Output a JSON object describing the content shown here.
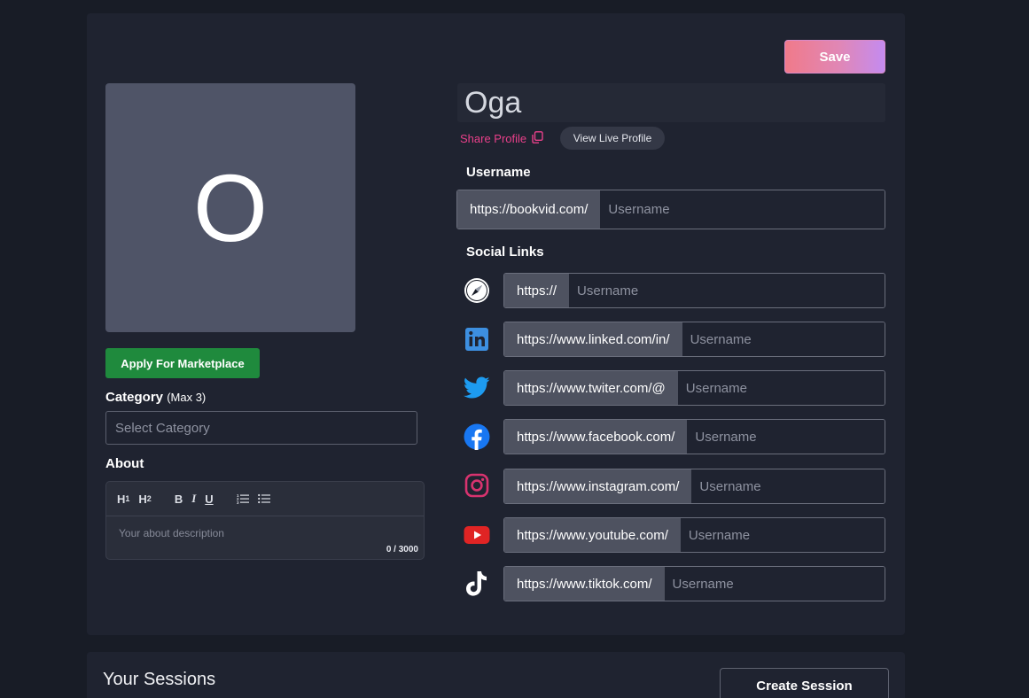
{
  "profile": {
    "save_label": "Save",
    "avatar_initial": "O",
    "name": "Oga",
    "share_label": "Share Profile",
    "view_live_label": "View Live Profile",
    "apply_marketplace_label": "Apply For Marketplace",
    "category": {
      "label": "Category",
      "hint": "(Max 3)",
      "placeholder": "Select Category"
    },
    "about": {
      "label": "About",
      "toolbar": [
        "H1",
        "H2",
        "B",
        "I",
        "U",
        "ordered-list",
        "bullet-list"
      ],
      "placeholder": "Your about description",
      "counter": "0 / 3000"
    },
    "username": {
      "label": "Username",
      "prefix": "https://bookvid.com/",
      "placeholder": "Username"
    },
    "social_links": {
      "label": "Social Links",
      "items": [
        {
          "icon": "safari-icon",
          "prefix": "https://",
          "placeholder": "Username"
        },
        {
          "icon": "linkedin-icon",
          "prefix": "https://www.linked.com/in/",
          "placeholder": "Username"
        },
        {
          "icon": "twitter-icon",
          "prefix": "https://www.twiter.com/@",
          "placeholder": "Username"
        },
        {
          "icon": "facebook-icon",
          "prefix": "https://www.facebook.com/",
          "placeholder": "Username"
        },
        {
          "icon": "instagram-icon",
          "prefix": "https://www.instagram.com/",
          "placeholder": "Username"
        },
        {
          "icon": "youtube-icon",
          "prefix": "https://www.youtube.com/",
          "placeholder": "Username"
        },
        {
          "icon": "tiktok-icon",
          "prefix": "https://www.tiktok.com/",
          "placeholder": "Username"
        }
      ]
    }
  },
  "sessions": {
    "title": "Your Sessions",
    "create_label": "Create Session"
  },
  "colors": {
    "background": "#181c26",
    "card": "#1f2330",
    "accent_pink": "#e9408a",
    "marketplace_green": "#1f8a3d",
    "linkedin": "#3d8fe0",
    "twitter": "#1d9bf0",
    "facebook": "#1877f2",
    "instagram": "#d8336f",
    "youtube": "#e02424"
  }
}
